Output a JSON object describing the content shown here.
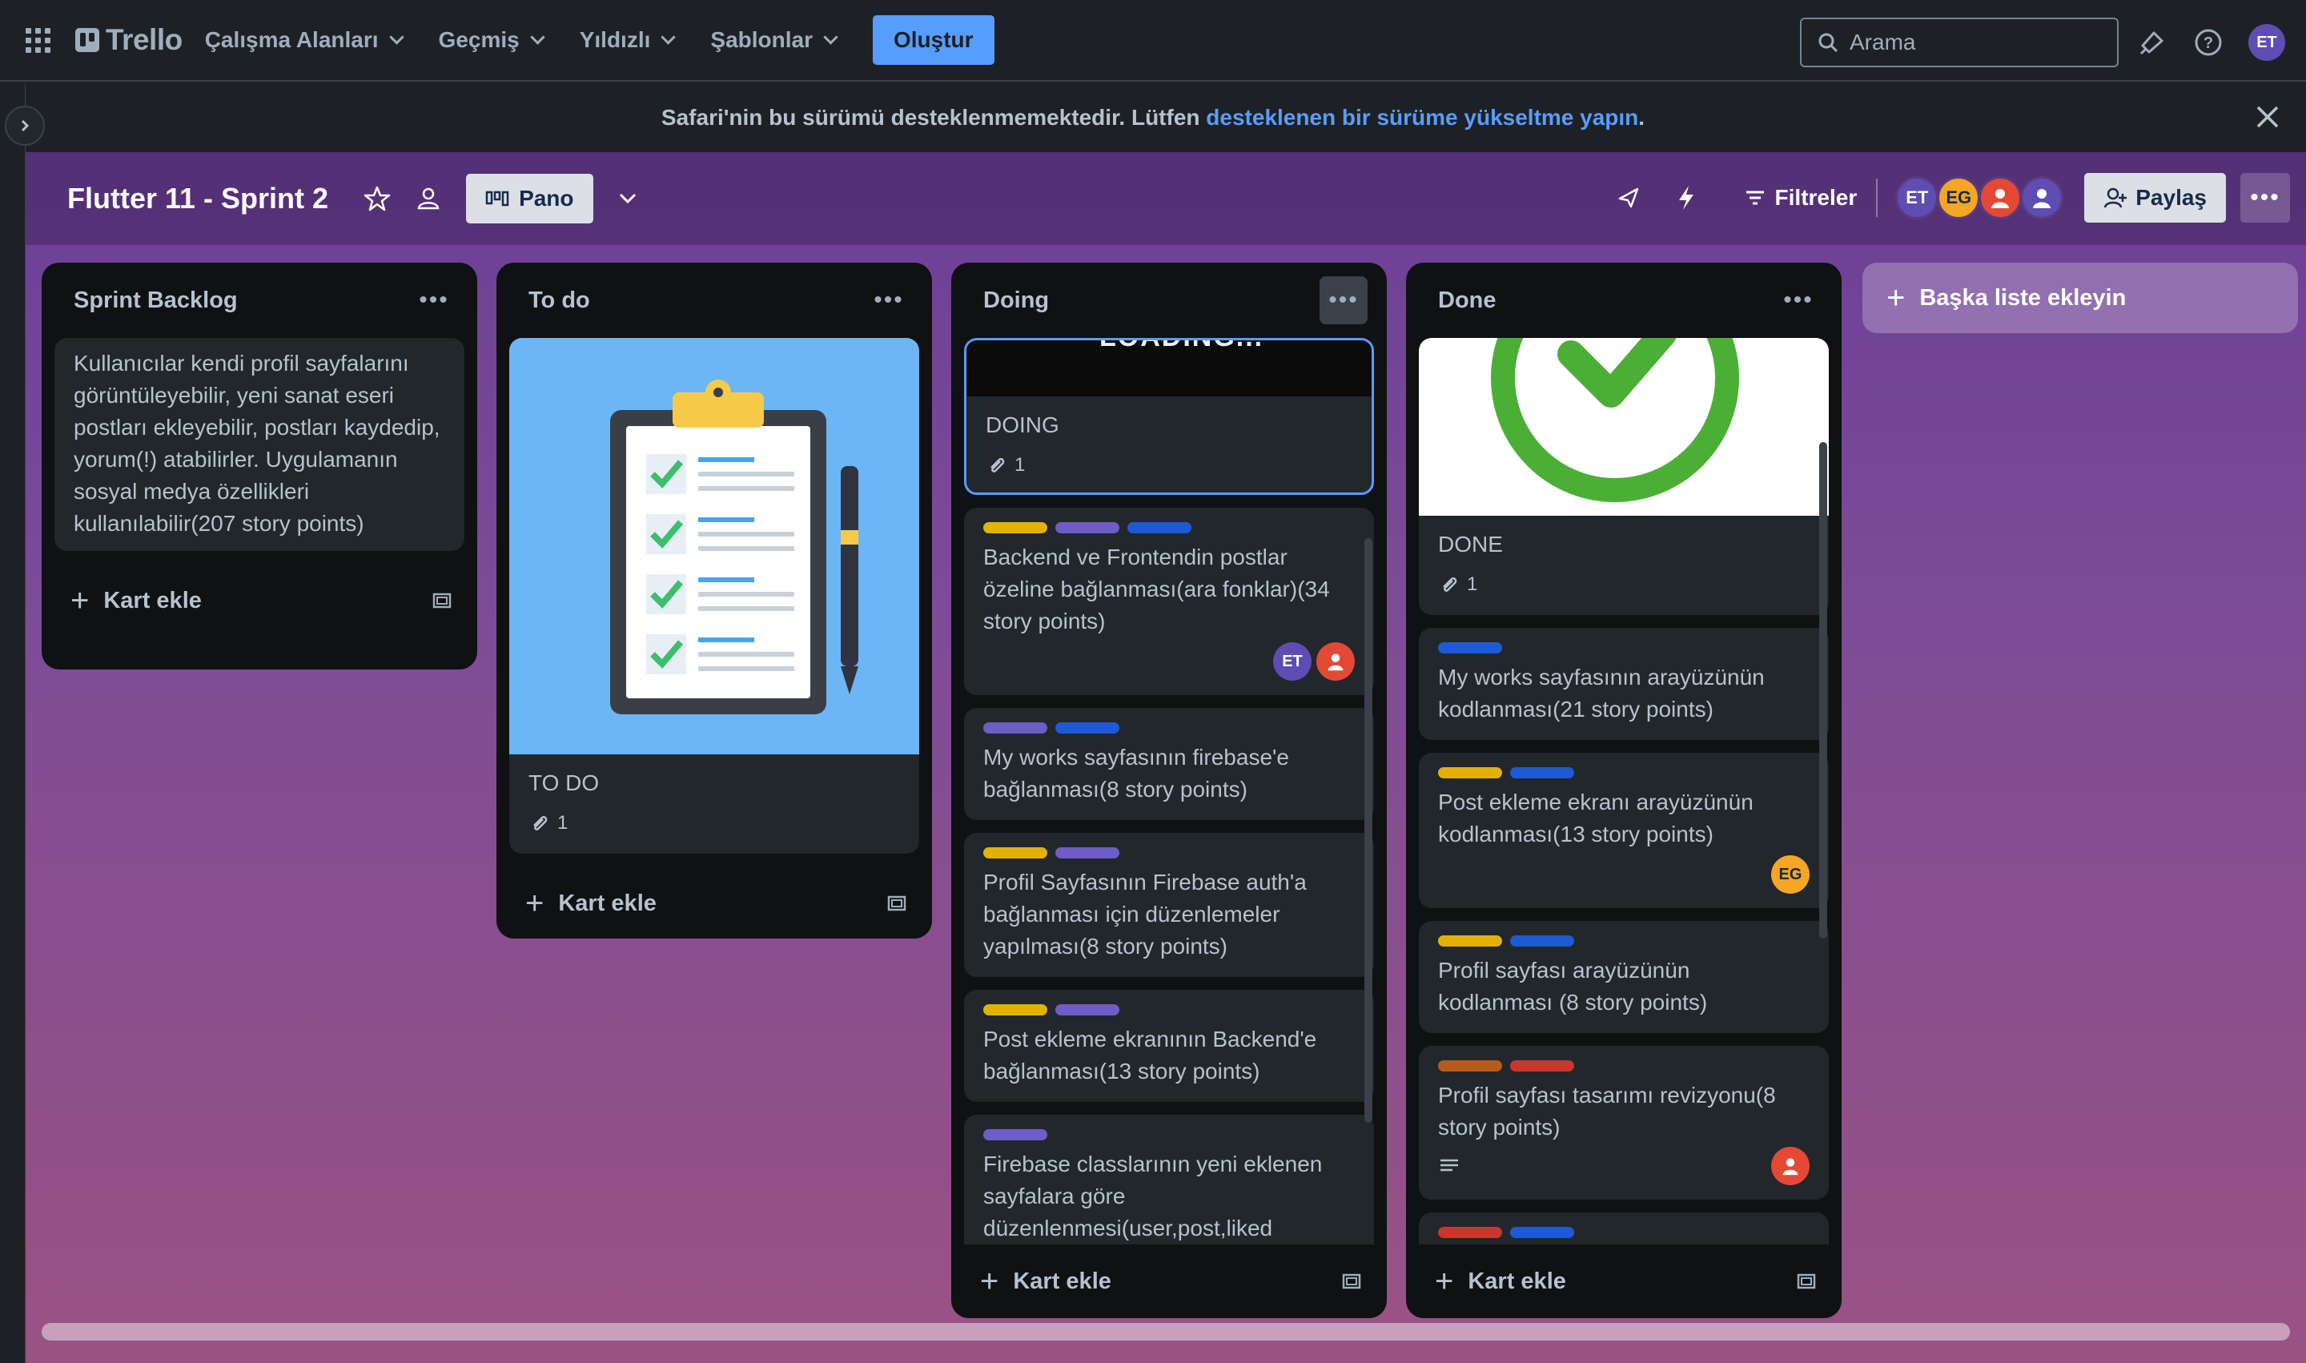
{
  "nav": {
    "logo": "Trello",
    "items": [
      "Çalışma Alanları",
      "Geçmiş",
      "Yıldızlı",
      "Şablonlar"
    ],
    "create": "Oluştur",
    "search_placeholder": "Arama",
    "user_initials": "ET"
  },
  "banner": {
    "text": "Safari'nin bu sürümü desteklenmemektedir. Lütfen ",
    "link": "desteklenen bir sürüme yükseltme yapın",
    "end": "."
  },
  "board": {
    "title": "Flutter 11 - Sprint 2",
    "view": "Pano",
    "filters": "Filtreler",
    "share": "Paylaş",
    "members": [
      "ET",
      "EG"
    ]
  },
  "lists": [
    {
      "title": "Sprint Backlog",
      "cards": [
        {
          "text": "Kullanıcılar kendi profil sayfalarını görüntüleyebilir, yeni sanat eseri postları ekleyebilir, postları kaydedip, yorum(!) atabilirler. Uygulamanın sosyal medya özellikleri kullanılabilir(207 story points)"
        }
      ],
      "add": "Kart ekle"
    },
    {
      "title": "To do",
      "cards": [
        {
          "text": "TO DO",
          "attachments": "1"
        }
      ],
      "add": "Kart ekle"
    },
    {
      "title": "Doing",
      "cards": [
        {
          "cover_text": "LOADING...",
          "text": "DOING",
          "attachments": "1"
        },
        {
          "text": "Backend ve Frontendin postlar özeline bağlanması(ara fonklar)(34 story points)",
          "members": [
            "ET",
            "user"
          ]
        },
        {
          "text": "My works sayfasının firebase'e bağlanması(8 story points)"
        },
        {
          "text": "Profil Sayfasının Firebase auth'a bağlanması için düzenlemeler yapılması(8 story points)"
        },
        {
          "text": "Post ekleme ekranının Backend'e bağlanması(13 story points)"
        },
        {
          "text": "Firebase classlarının yeni eklenen sayfalara göre düzenlenmesi(user,post,liked"
        }
      ],
      "add": "Kart ekle"
    },
    {
      "title": "Done",
      "cards": [
        {
          "text": "DONE",
          "attachments": "1"
        },
        {
          "text": "My works sayfasının arayüzünün kodlanması(21 story points)"
        },
        {
          "text": "Post ekleme ekranı arayüzünün kodlanması(13 story points)",
          "members": [
            "EG"
          ]
        },
        {
          "text": "Profil sayfası arayüzünün kodlanması (8 story points)"
        },
        {
          "text": "Profil sayfası tasarımı revizyonu(8 story points)",
          "members": [
            "user"
          ]
        }
      ],
      "add": "Kart ekle"
    }
  ],
  "add_list": "Başka liste ekleyin",
  "colors": {
    "yellow": "#e2b203",
    "purple": "#6e5dc6",
    "blue": "#1d5ad6",
    "orange": "#b65c1a",
    "red": "#c9372c",
    "avatar_et": "#5e4db2",
    "avatar_eg": "#f5a623",
    "avatar_user": "#e34935"
  }
}
